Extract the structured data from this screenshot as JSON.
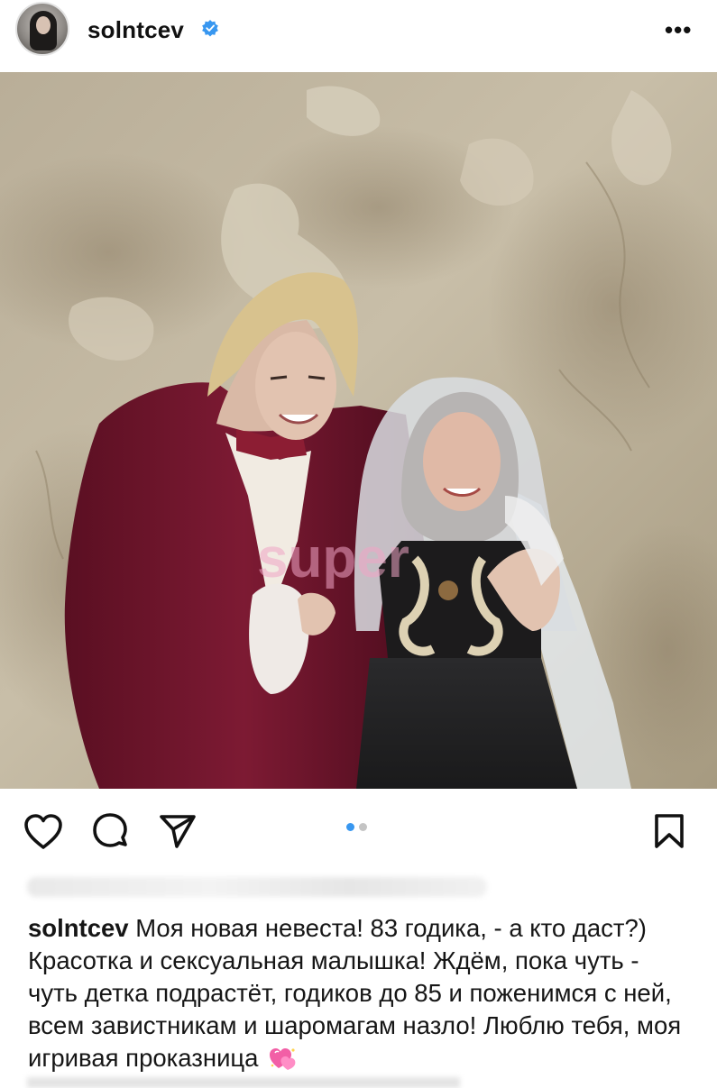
{
  "post": {
    "username": "solntcev",
    "verified": true,
    "more_label": "•••",
    "watermark": "super",
    "carousel": {
      "count": 2,
      "active": 1
    },
    "caption_user": "solntcev",
    "caption_text": "Моя новая невеста! 83 годика, - а кто даст?) Красотка и сексуальная малышка! Ждём, пока чуть - чуть детка подрастёт, годиков до 85 и поженимся с ней, всем завистникам и шаромагам назло! Люблю тебя, моя игривая проказница"
  },
  "icons": {
    "like": "heart-outline-icon",
    "comment": "speech-bubble-icon",
    "share": "paper-plane-icon",
    "save": "bookmark-icon",
    "caption_emoji": "sparkling-hearts-emoji"
  },
  "colors": {
    "verified_badge": "#3897f0",
    "carousel_active": "#3897f0",
    "carousel_inactive": "#c4c4c4",
    "emoji_pink": "#f25fa6"
  }
}
